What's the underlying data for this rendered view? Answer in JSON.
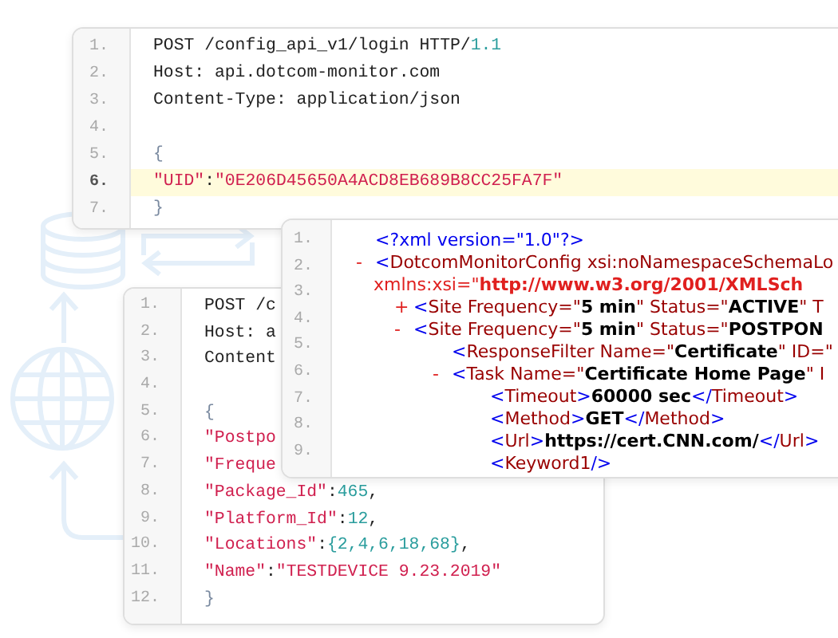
{
  "panels": [
    {
      "kind": "code",
      "line_numbers": [
        "1.",
        "2.",
        "3.",
        "4.",
        "5.",
        "6.",
        "7."
      ],
      "lines": [
        {
          "highlighted": false,
          "tokens": [
            {
              "text": "POST /config_api_v1/login HTTP/",
              "kind": "plain"
            },
            {
              "text": "1.1",
              "kind": "number"
            }
          ]
        },
        {
          "highlighted": false,
          "tokens": [
            {
              "text": "Host: api.dotcom-monitor.com",
              "kind": "plain"
            }
          ]
        },
        {
          "highlighted": false,
          "tokens": [
            {
              "text": "Content-Type: application/json",
              "kind": "plain"
            }
          ]
        },
        {
          "highlighted": false
        },
        {
          "highlighted": false,
          "tokens": [
            {
              "text": "{",
              "kind": "punct"
            }
          ]
        },
        {
          "highlighted": true,
          "tokens": [
            {
              "text": "\"UID\"",
              "kind": "string"
            },
            {
              "text": ":",
              "kind": "plain"
            },
            {
              "text": "\"0E206D45650A4ACD8EB689B8CC25FA7F\"",
              "kind": "string"
            }
          ]
        },
        {
          "highlighted": false,
          "tokens": [
            {
              "text": "}",
              "kind": "punct"
            }
          ]
        }
      ]
    },
    {
      "kind": "code",
      "line_numbers": [
        "1.",
        "2.",
        "3.",
        "4.",
        "5.",
        "6.",
        "7.",
        "8.",
        "9.",
        "10.",
        "11.",
        "12."
      ],
      "lines": [
        {
          "highlighted": false,
          "tokens": [
            {
              "text": "POST /c",
              "kind": "plain"
            }
          ]
        },
        {
          "highlighted": false,
          "tokens": [
            {
              "text": "Host: a",
              "kind": "plain"
            }
          ]
        },
        {
          "highlighted": false,
          "tokens": [
            {
              "text": "Content",
              "kind": "plain"
            }
          ]
        },
        {
          "highlighted": false
        },
        {
          "highlighted": false,
          "tokens": [
            {
              "text": "{",
              "kind": "punct"
            }
          ]
        },
        {
          "highlighted": false,
          "tokens": [
            {
              "text": "\"Postpo",
              "kind": "string"
            }
          ]
        },
        {
          "highlighted": false,
          "tokens": [
            {
              "text": "\"Freque",
              "kind": "string"
            }
          ]
        },
        {
          "highlighted": false,
          "tokens": [
            {
              "text": "\"Package_Id\"",
              "kind": "string"
            },
            {
              "text": ":",
              "kind": "plain"
            },
            {
              "text": "465",
              "kind": "number"
            },
            {
              "text": ",",
              "kind": "plain"
            }
          ]
        },
        {
          "highlighted": false,
          "tokens": [
            {
              "text": "\"Platform_Id\"",
              "kind": "string"
            },
            {
              "text": ":",
              "kind": "plain"
            },
            {
              "text": "12",
              "kind": "number"
            },
            {
              "text": ",",
              "kind": "plain"
            }
          ]
        },
        {
          "highlighted": false,
          "tokens": [
            {
              "text": "\"Locations\"",
              "kind": "string"
            },
            {
              "text": ":",
              "kind": "plain"
            },
            {
              "text": "{2,4,6,18,68}",
              "kind": "number"
            },
            {
              "text": ",",
              "kind": "plain"
            }
          ]
        },
        {
          "highlighted": false,
          "tokens": [
            {
              "text": "\"Name\"",
              "kind": "string"
            },
            {
              "text": ":",
              "kind": "plain"
            },
            {
              "text": "\"TESTDEVICE 9.23.2019\"",
              "kind": "string"
            }
          ]
        },
        {
          "highlighted": false,
          "tokens": [
            {
              "text": "}",
              "kind": "punct"
            }
          ]
        }
      ]
    },
    {
      "kind": "xml",
      "line_numbers": [
        "1.",
        "2.",
        "3.",
        "4.",
        "5.",
        "6.",
        "7.",
        "8.",
        "9."
      ],
      "nodes": [
        {
          "tokens": [
            {
              "text": "<?",
              "kind": "punct"
            },
            {
              "text": "xml version=\"1.0\"",
              "kind": "punct"
            },
            {
              "text": "?>",
              "kind": "punct"
            }
          ]
        },
        {
          "toggle": "-",
          "tokens": [
            {
              "text": "<",
              "kind": "punct"
            },
            {
              "text": "DotcomMonitorConfig xsi:noNamespaceSchemaLo",
              "kind": "name"
            }
          ],
          "continuation": [
            {
              "text": "xmlns:xsi=\"",
              "kind": "ns"
            },
            {
              "text": "http://www.w3.org/2001/XMLSch",
              "kind": "nsvalue"
            }
          ],
          "children": [
            {
              "toggle": "+",
              "tokens": [
                {
                  "text": "<",
                  "kind": "punct"
                },
                {
                  "text": "Site Frequency=\"",
                  "kind": "name"
                },
                {
                  "text": "5 min",
                  "kind": "value"
                },
                {
                  "text": "\" Status=\"",
                  "kind": "name"
                },
                {
                  "text": "ACTIVE",
                  "kind": "value"
                },
                {
                  "text": "\" T",
                  "kind": "name"
                }
              ]
            },
            {
              "toggle": "-",
              "tokens": [
                {
                  "text": "<",
                  "kind": "punct"
                },
                {
                  "text": "Site Frequency=\"",
                  "kind": "name"
                },
                {
                  "text": "5 min",
                  "kind": "value"
                },
                {
                  "text": "\" Status=\"",
                  "kind": "name"
                },
                {
                  "text": "POSTPON",
                  "kind": "value"
                }
              ],
              "children": [
                {
                  "tokens": [
                    {
                      "text": "<",
                      "kind": "punct"
                    },
                    {
                      "text": "ResponseFilter Name=\"",
                      "kind": "name"
                    },
                    {
                      "text": "Certificate",
                      "kind": "value"
                    },
                    {
                      "text": "\" ID=\"",
                      "kind": "name"
                    }
                  ]
                },
                {
                  "toggle": "-",
                  "tokens": [
                    {
                      "text": "<",
                      "kind": "punct"
                    },
                    {
                      "text": "Task Name=\"",
                      "kind": "name"
                    },
                    {
                      "text": "Certificate Home Page",
                      "kind": "value"
                    },
                    {
                      "text": "\" I",
                      "kind": "name"
                    }
                  ],
                  "children": [
                    {
                      "tokens": [
                        {
                          "text": "<",
                          "kind": "punct"
                        },
                        {
                          "text": "Timeout",
                          "kind": "name"
                        },
                        {
                          "text": ">",
                          "kind": "punct"
                        },
                        {
                          "text": "60000 sec",
                          "kind": "value"
                        },
                        {
                          "text": "</",
                          "kind": "punct"
                        },
                        {
                          "text": "Timeout",
                          "kind": "name"
                        },
                        {
                          "text": ">",
                          "kind": "punct"
                        }
                      ]
                    },
                    {
                      "tokens": [
                        {
                          "text": "<",
                          "kind": "punct"
                        },
                        {
                          "text": "Method",
                          "kind": "name"
                        },
                        {
                          "text": ">",
                          "kind": "punct"
                        },
                        {
                          "text": "GET",
                          "kind": "value"
                        },
                        {
                          "text": "</",
                          "kind": "punct"
                        },
                        {
                          "text": "Method",
                          "kind": "name"
                        },
                        {
                          "text": ">",
                          "kind": "punct"
                        }
                      ]
                    },
                    {
                      "tokens": [
                        {
                          "text": "<",
                          "kind": "punct"
                        },
                        {
                          "text": "Url",
                          "kind": "name"
                        },
                        {
                          "text": ">",
                          "kind": "punct"
                        },
                        {
                          "text": "https://cert.CNN.com/",
                          "kind": "value"
                        },
                        {
                          "text": "</",
                          "kind": "punct"
                        },
                        {
                          "text": "Url",
                          "kind": "name"
                        },
                        {
                          "text": ">",
                          "kind": "punct"
                        }
                      ]
                    },
                    {
                      "tokens": [
                        {
                          "text": "<",
                          "kind": "punct"
                        },
                        {
                          "text": "Keyword1",
                          "kind": "name"
                        },
                        {
                          "text": "/>",
                          "kind": "punct"
                        }
                      ]
                    }
                  ]
                }
              ]
            }
          ]
        }
      ]
    }
  ]
}
